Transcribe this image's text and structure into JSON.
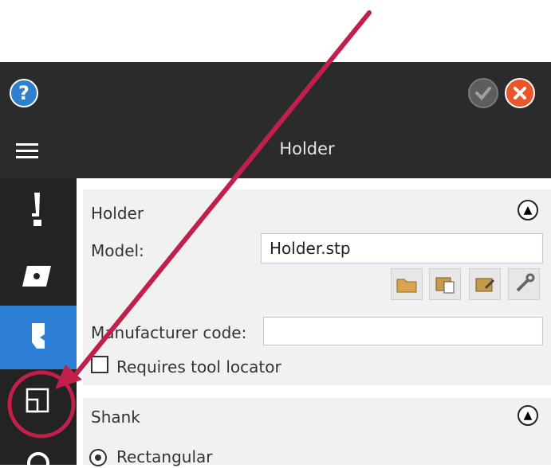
{
  "window": {
    "title": "Holder",
    "help_icon": "help-circle-icon",
    "ok_icon": "check-circle-icon",
    "close_icon": "close-circle-icon",
    "menu_icon": "hamburger-menu-icon"
  },
  "sidebar": {
    "items": [
      {
        "name": "tool-assembly",
        "icon": "tool-icon"
      },
      {
        "name": "insert",
        "icon": "insert-icon"
      },
      {
        "name": "holder",
        "icon": "holder-icon",
        "active": true
      },
      {
        "name": "adaptor",
        "icon": "adaptor-icon"
      },
      {
        "name": "settings",
        "icon": "gear-icon"
      }
    ]
  },
  "holder_section": {
    "title": "Holder",
    "model_label": "Model:",
    "model_value": "Holder.stp",
    "manufacturer_label": "Manufacturer code:",
    "manufacturer_value": "",
    "requires_locator_label": "Requires tool locator"
  },
  "shank_section": {
    "title": "Shank",
    "radio_rectangular_label": "Rectangular"
  },
  "colors": {
    "accent": "#2d7fd5",
    "annotation": "#c0204a"
  }
}
